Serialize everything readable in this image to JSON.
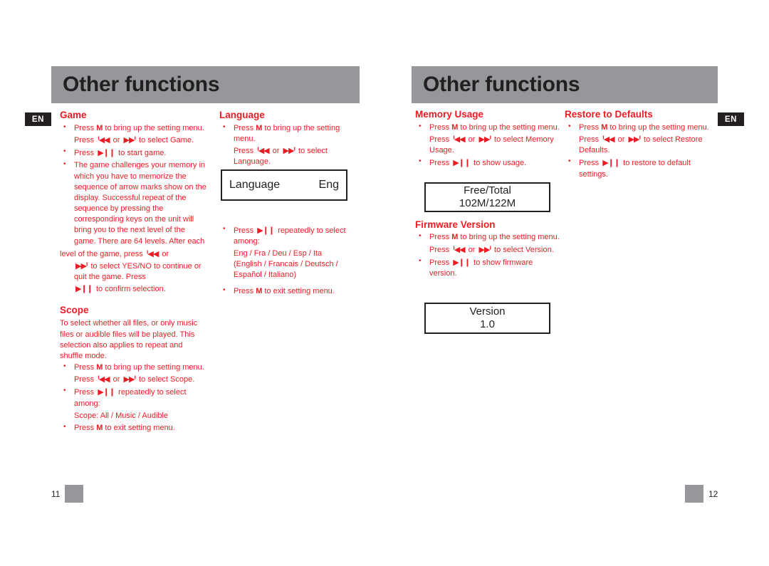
{
  "banners": {
    "left_title": "Other functions",
    "right_title": "Other functions"
  },
  "badges": {
    "left": "EN",
    "right": "EN"
  },
  "icons": {
    "prev": "ᑊ◀◀",
    "next": "▶▶ᑊ",
    "play_pause": "▶❙❙",
    "prev_name": "previous-track-icon",
    "next_name": "next-track-icon",
    "play_name": "play-pause-icon"
  },
  "colors": {
    "accent_red": "#ed1c24",
    "banner_gray": "#95979a",
    "ink": "#231f20"
  },
  "sections": {
    "game": {
      "heading": "Game",
      "b1_a": "Press ",
      "b1_m": "M",
      "b1_b": " to bring up the setting menu.",
      "b1_c": "Press ",
      "b1_or": " or ",
      "b1_d": " to select Game.",
      "b2_a": "Press ",
      "b2_b": " to start game.",
      "b3": "The game challenges your memory in which you have to memorize the sequence of arrow marks show on the display. Successful repeat of the sequence by pressing the corresponding keys on the unit will bring you to the next level of the game. There are 64 levels. After each",
      "b4_a": "level of the game, press ",
      "b4_or": " or",
      "b4_b": " to select YES/NO to continue or quit the game. Press",
      "b4_c": " to confirm selection."
    },
    "scope": {
      "heading": "Scope",
      "intro": "To select whether all files, or only music files or audible files will be played. This selection also applies to repeat and shuffle mode.",
      "b1_a": "Press ",
      "b1_m": "M",
      "b1_b": " to bring up the setting menu.",
      "b1_c": "Press ",
      "b1_or": " or ",
      "b1_d": " to select Scope.",
      "b2_a": "Press ",
      "b2_b": " repeatedly to select among:",
      "options": "Scope: All / Music / Audible",
      "b3_a": "Press ",
      "b3_m": "M",
      "b3_b": " to exit setting menu."
    },
    "language": {
      "heading": "Language",
      "b1_a": "Press ",
      "b1_m": "M",
      "b1_b": " to bring up the setting menu.",
      "b1_c": "Press ",
      "b1_or": " or ",
      "b1_d": " to select Language.",
      "lcd_label": "Language",
      "lcd_value": "Eng",
      "b2_a": "Press ",
      "b2_b": " repeatedly to select among:",
      "options_codes": "Eng / Fra / Deu / Esp / Ita",
      "options_names": "(English / Francais / Deutsch / Español / Italiano)",
      "b3_a": "Press ",
      "b3_m": "M",
      "b3_b": " to exit setting menu."
    },
    "memory_usage": {
      "heading": "Memory Usage",
      "b1_a": "Press ",
      "b1_m": "M",
      "b1_b": " to bring up the setting menu.",
      "b1_c": "Press ",
      "b1_or": " or ",
      "b1_d": " to select Memory Usage.",
      "b2_a": "Press ",
      "b2_b": " to show usage.",
      "lcd_line1": "Free/Total",
      "lcd_line2": "102M/122M"
    },
    "firmware_version": {
      "heading": "Firmware Version",
      "b1_a": "Press ",
      "b1_m": "M",
      "b1_b": " to bring up the setting menu.",
      "b1_c": "Press ",
      "b1_or": " or ",
      "b1_d": " to select Version.",
      "b2_a": "Press ",
      "b2_b": " to show firmware version.",
      "lcd_line1": "Version",
      "lcd_line2": "1.0"
    },
    "restore_defaults": {
      "heading": "Restore to Defaults",
      "b1_a": "Press ",
      "b1_m": "M",
      "b1_b": " to bring up the setting menu.",
      "b1_c": "Press ",
      "b1_or": " or ",
      "b1_d": " to select Restore Defaults.",
      "b2_a": "Press ",
      "b2_b": " to restore to default settings."
    }
  },
  "footers": {
    "left_page": "11",
    "right_page": "12"
  }
}
